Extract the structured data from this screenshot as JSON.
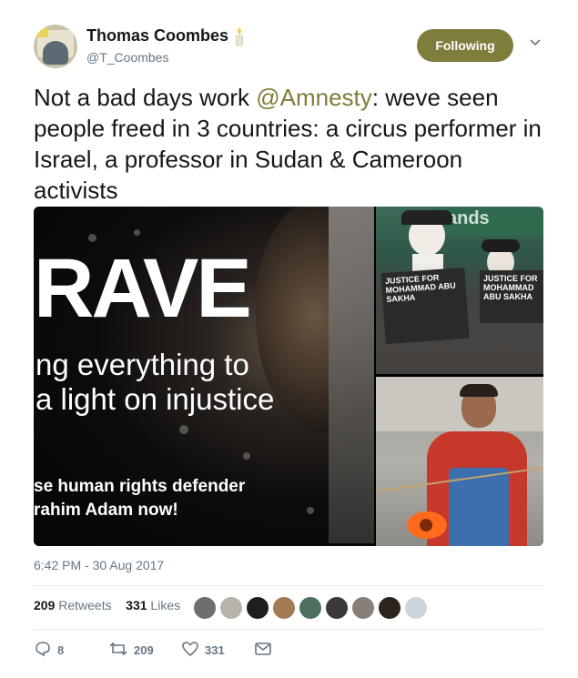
{
  "author": {
    "name": "Thomas Coombes",
    "handle": "@T_Coombes"
  },
  "follow_button": {
    "label": "Following"
  },
  "tweet": {
    "text_before": "Not a bad days work ",
    "mention": "@Amnesty",
    "text_after": ": weve seen people freed in 3 countries: a circus performer in Israel, a professor in Sudan & Cameroon activists"
  },
  "media": {
    "main": {
      "line1": "RAVE",
      "line2": "ng everything to",
      "line3": "a light on injustice",
      "line4": "se human rights defender",
      "line5": "rahim Adam now!"
    },
    "top_right": {
      "store_text": "ands",
      "sign_left": "JUSTICE FOR MOHAMMAD ABU SAKHA",
      "sign_right": "JUSTICE FOR MOHAMMAD ABU SAKHA"
    }
  },
  "timestamp": "6:42 PM - 30 Aug 2017",
  "stats": {
    "retweets_count": "209",
    "retweets_label": "Retweets",
    "likes_count": "331",
    "likes_label": "Likes"
  },
  "actions": {
    "reply_count": "8",
    "retweet_count": "209",
    "like_count": "331"
  },
  "colors": {
    "accent": "#7f7d3b",
    "secondary_text": "#657786",
    "divider": "#e6ecf0"
  },
  "icons": [
    "candle-icon",
    "chevron-down-icon",
    "reply-icon",
    "retweet-icon",
    "heart-icon",
    "message-icon"
  ]
}
